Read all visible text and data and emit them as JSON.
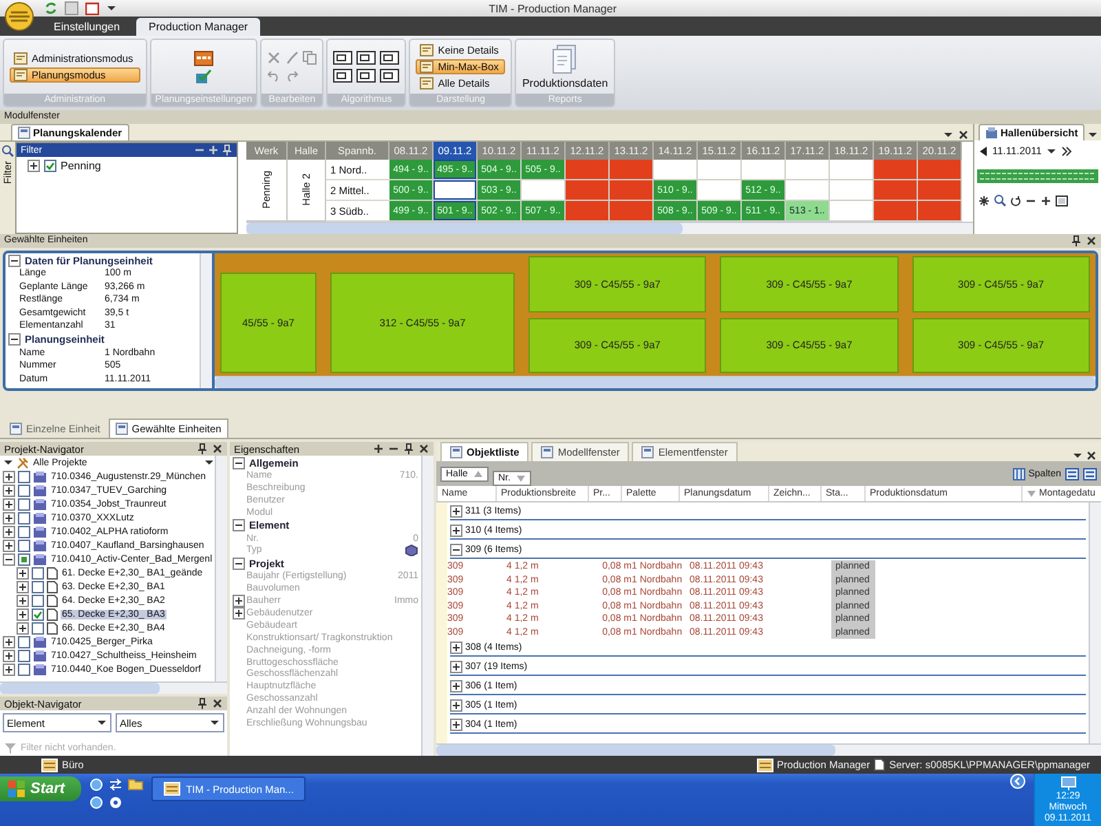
{
  "title_bar": {
    "title": "TIM - Production Manager"
  },
  "ribbon": {
    "tabs": [
      {
        "label": "Einstellungen",
        "selected": false
      },
      {
        "label": "Production Manager",
        "selected": true
      }
    ],
    "groups": [
      {
        "title": "Administration",
        "kind": "modes",
        "items": [
          {
            "label": "Administrationsmodus",
            "selected": false
          },
          {
            "label": "Planungsmodus",
            "selected": true
          }
        ]
      },
      {
        "title": "Planungseinstellungen",
        "kind": "settings"
      },
      {
        "title": "Bearbeiten",
        "kind": "edit"
      },
      {
        "title": "Algorithmus",
        "kind": "layout"
      },
      {
        "title": "Darstellung",
        "kind": "modes",
        "items": [
          {
            "label": "Keine Details",
            "selected": false
          },
          {
            "label": "Min-Max-Box",
            "selected": true
          },
          {
            "label": "Alle Details",
            "selected": false
          }
        ]
      },
      {
        "title": "Reports",
        "kind": "report",
        "button": "Produktionsdaten"
      }
    ]
  },
  "module_window": {
    "title": "Modulfenster",
    "tab": "Planungskalender",
    "filter": {
      "side_label": "Filter",
      "title": "Filter",
      "items": [
        {
          "label": "Penning",
          "checked": true
        }
      ]
    },
    "calendar": {
      "headers": [
        "Werk",
        "Halle",
        "Spannb."
      ],
      "werk": "Penning",
      "halle": "Halle 2",
      "dates": [
        {
          "label": "08.11.2",
          "selected": false
        },
        {
          "label": "09.11.2",
          "selected": true
        },
        {
          "label": "10.11.2",
          "selected": false
        },
        {
          "label": "11.11.2",
          "selected": false
        },
        {
          "label": "12.11.2",
          "selected": false
        },
        {
          "label": "13.11.2",
          "selected": false
        },
        {
          "label": "14.11.2",
          "selected": false
        },
        {
          "label": "15.11.2",
          "selected": false
        },
        {
          "label": "16.11.2",
          "selected": false
        },
        {
          "label": "17.11.2",
          "selected": false
        },
        {
          "label": "18.11.2",
          "selected": false
        },
        {
          "label": "19.11.2",
          "selected": false
        },
        {
          "label": "20.11.2",
          "selected": false
        }
      ],
      "rows": [
        {
          "label": "1 Nord..",
          "cells": [
            {
              "kind": "planned",
              "text": "494 - 9.."
            },
            {
              "kind": "planned",
              "text": "495 - 9.."
            },
            {
              "kind": "planned",
              "text": "504 - 9.."
            },
            {
              "kind": "planned",
              "text": "505 - 9.."
            },
            {
              "kind": "blocked"
            },
            {
              "kind": "blocked"
            },
            {
              "kind": "free"
            },
            {
              "kind": "free"
            },
            {
              "kind": "free"
            },
            {
              "kind": "free"
            },
            {
              "kind": "free"
            },
            {
              "kind": "blocked"
            },
            {
              "kind": "blocked"
            }
          ]
        },
        {
          "label": "2 Mittel..",
          "cells": [
            {
              "kind": "planned",
              "text": "500 - 9.."
            },
            {
              "kind": "free"
            },
            {
              "kind": "planned",
              "text": "503 - 9.."
            },
            {
              "kind": "free"
            },
            {
              "kind": "blocked"
            },
            {
              "kind": "blocked"
            },
            {
              "kind": "planned",
              "text": "510 - 9.."
            },
            {
              "kind": "free"
            },
            {
              "kind": "planned",
              "text": "512 - 9.."
            },
            {
              "kind": "free"
            },
            {
              "kind": "free"
            },
            {
              "kind": "blocked"
            },
            {
              "kind": "blocked"
            }
          ]
        },
        {
          "label": "3 Südb..",
          "cells": [
            {
              "kind": "planned",
              "text": "499 - 9.."
            },
            {
              "kind": "planned",
              "text": "501 - 9.."
            },
            {
              "kind": "planned",
              "text": "502 - 9.."
            },
            {
              "kind": "planned",
              "text": "507 - 9.."
            },
            {
              "kind": "blocked"
            },
            {
              "kind": "blocked"
            },
            {
              "kind": "planned",
              "text": "508 - 9.."
            },
            {
              "kind": "planned",
              "text": "509 - 9.."
            },
            {
              "kind": "planned",
              "text": "511 - 9.."
            },
            {
              "kind": "partial",
              "text": "513 - 1.."
            },
            {
              "kind": "free"
            },
            {
              "kind": "blocked"
            },
            {
              "kind": "blocked"
            }
          ]
        }
      ]
    },
    "hall_overview": {
      "tab": "Hallenübersicht",
      "date": "11.11.2011"
    }
  },
  "selected_units": {
    "title": "Gewählte Einheiten",
    "groups": [
      {
        "title": "Daten für Planungseinheit",
        "rows": [
          {
            "label": "Länge",
            "value": "100 m"
          },
          {
            "label": "Geplante Länge",
            "value": "93,266 m"
          },
          {
            "label": "Restlänge",
            "value": "6,734 m"
          },
          {
            "label": "Gesamtgewicht",
            "value": "39,5 t"
          },
          {
            "label": "Elementanzahl",
            "value": "31"
          }
        ]
      },
      {
        "title": "Planungseinheit",
        "rows": [
          {
            "label": "Name",
            "value": "1 Nordbahn"
          },
          {
            "label": "Nummer",
            "value": "505"
          },
          {
            "label": "Datum",
            "value": "11.11.2011"
          }
        ]
      }
    ],
    "units": [
      {
        "label": "45/55 -  9a7",
        "kind": "full"
      },
      {
        "label": "312 - C45/55 -  9a7",
        "kind": "full"
      },
      {
        "label": "309 - C45/55 -  9a7",
        "kind": "half"
      },
      {
        "label": "309 - C45/55 -  9a7",
        "kind": "half"
      },
      {
        "label": "309 - C45/55 -  9a7",
        "kind": "half"
      },
      {
        "label": "309 - C45/55 -  9a7",
        "kind": "half"
      },
      {
        "label": "309 - C45/55 -  9a7",
        "kind": "half"
      },
      {
        "label": "309 - C45/55 -  9a7",
        "kind": "half"
      }
    ]
  },
  "view_tabs": [
    {
      "label": "Einzelne Einheit",
      "selected": false
    },
    {
      "label": "Gewählte Einheiten",
      "selected": true
    }
  ],
  "project_navigator": {
    "title": "Projekt-Navigator",
    "root": "Alle Projekte",
    "items": [
      {
        "label": "710.0346_Augustenstr.29_München",
        "kind": "project",
        "checked": false,
        "indeterminate": false,
        "selected": false,
        "expanded": false
      },
      {
        "label": "710.0347_TUEV_Garching",
        "kind": "project",
        "checked": false,
        "indeterminate": false,
        "selected": false,
        "expanded": false
      },
      {
        "label": "710.0354_Jobst_Traunreut",
        "kind": "project",
        "checked": false,
        "indeterminate": false,
        "selected": false,
        "expanded": false
      },
      {
        "label": "710.0370_XXXLutz",
        "kind": "project",
        "checked": false,
        "indeterminate": false,
        "selected": false,
        "expanded": false
      },
      {
        "label": "710.0402_ALPHA ratioform",
        "kind": "project",
        "checked": false,
        "indeterminate": false,
        "selected": false,
        "expanded": false
      },
      {
        "label": "710.0407_Kaufland_Barsinghausen",
        "kind": "project",
        "checked": false,
        "indeterminate": false,
        "selected": false,
        "expanded": false
      },
      {
        "label": "710.0410_Activ-Center_Bad_Mergenl",
        "kind": "project",
        "checked": false,
        "indeterminate": true,
        "selected": false,
        "expanded": true,
        "children": [
          {
            "label": "61. Decke E+2,30_ BA1_geände",
            "kind": "document",
            "checked": false,
            "indeterminate": false,
            "selected": false,
            "expanded": false
          },
          {
            "label": "63. Decke E+2,30_ BA1",
            "kind": "document",
            "checked": false,
            "indeterminate": false,
            "selected": false,
            "expanded": false
          },
          {
            "label": "64. Decke E+2,30_ BA2",
            "kind": "document",
            "checked": false,
            "indeterminate": false,
            "selected": false,
            "expanded": false
          },
          {
            "label": "65. Decke E+2,30_ BA3",
            "kind": "document",
            "checked": true,
            "indeterminate": false,
            "selected": true,
            "expanded": false
          },
          {
            "label": "66. Decke E+2,30_ BA4",
            "kind": "document",
            "checked": false,
            "indeterminate": false,
            "selected": false,
            "expanded": false
          }
        ]
      },
      {
        "label": "710.0425_Berger_Pirka",
        "kind": "project",
        "checked": false,
        "indeterminate": false,
        "selected": false,
        "expanded": false
      },
      {
        "label": "710.0427_Schultheiss_Heinsheim",
        "kind": "project",
        "checked": false,
        "indeterminate": false,
        "selected": false,
        "expanded": false
      },
      {
        "label": "710.0440_Koe Bogen_Duesseldorf",
        "kind": "project",
        "checked": false,
        "indeterminate": false,
        "selected": false,
        "expanded": false
      }
    ]
  },
  "object_navigator": {
    "title": "Objekt-Navigator",
    "type": "Element",
    "filter": "Alles",
    "footer": "Filter nicht vorhanden."
  },
  "properties": {
    "title": "Eigenschaften",
    "groups": [
      {
        "title": "Allgemein",
        "rows": [
          {
            "label": "Name",
            "kind": "text",
            "value": "710."
          },
          {
            "label": "Beschreibung",
            "kind": "text"
          },
          {
            "label": "Benutzer",
            "kind": "text"
          },
          {
            "label": "Modul",
            "kind": "text"
          }
        ]
      },
      {
        "title": "Element",
        "rows": [
          {
            "label": "Nr.",
            "kind": "text",
            "value": "0"
          },
          {
            "label": "Typ",
            "kind": "icon"
          }
        ]
      },
      {
        "title": "Projekt",
        "rows": [
          {
            "label": "Baujahr (Fertigstellung)",
            "kind": "text",
            "value": "2011"
          },
          {
            "label": "Bauvolumen",
            "kind": "text"
          },
          {
            "label": "Bauherr",
            "kind": "group",
            "value": "Immo"
          },
          {
            "label": "Gebäudenutzer",
            "kind": "group"
          },
          {
            "label": "Gebäudeart",
            "kind": "text"
          },
          {
            "label": "Konstruktionsart/ Tragkonstruktion",
            "kind": "text"
          },
          {
            "label": "Dachneigung, -form",
            "kind": "text"
          },
          {
            "label": "Bruttogeschossfläche",
            "kind": "text"
          },
          {
            "label": "Geschossflächenzahl",
            "kind": "text"
          },
          {
            "label": "Hauptnutzfläche",
            "kind": "text"
          },
          {
            "label": "Geschossanzahl",
            "kind": "text"
          },
          {
            "label": "Anzahl der Wohnungen",
            "kind": "text"
          },
          {
            "label": "Erschließung Wohnungsbau",
            "kind": "text"
          }
        ]
      }
    ]
  },
  "object_list": {
    "tabs": [
      {
        "label": "Objektliste",
        "selected": true
      },
      {
        "label": "Modellfenster",
        "selected": false
      },
      {
        "label": "Elementfenster",
        "selected": false
      }
    ],
    "group_by": [
      "Halle",
      "Nr."
    ],
    "columns_button": "Spalten",
    "columns": [
      "Name",
      "Produktionsbreite",
      "Pr...",
      "Palette",
      "Planungsdatum",
      "Zeichn...",
      "Sta...",
      "Produktionsdatum",
      "Montagedatu"
    ],
    "groups": [
      {
        "label": "311 (3 Items)",
        "expanded": false
      },
      {
        "label": "310 (4 Items)",
        "expanded": false
      },
      {
        "label": "309 (6 Items)",
        "expanded": true,
        "rows": [
          {
            "name": "309",
            "breite": "4 1,2 m",
            "pr": "0,08 m",
            "palette": "1 Nordbahn",
            "planungsdatum": "08.11.2011 09:43",
            "status": "planned"
          },
          {
            "name": "309",
            "breite": "4 1,2 m",
            "pr": "0,08 m",
            "palette": "1 Nordbahn",
            "planungsdatum": "08.11.2011 09:43",
            "status": "planned"
          },
          {
            "name": "309",
            "breite": "4 1,2 m",
            "pr": "0,08 m",
            "palette": "1 Nordbahn",
            "planungsdatum": "08.11.2011 09:43",
            "status": "planned"
          },
          {
            "name": "309",
            "breite": "4 1,2 m",
            "pr": "0,08 m",
            "palette": "1 Nordbahn",
            "planungsdatum": "08.11.2011 09:43",
            "status": "planned"
          },
          {
            "name": "309",
            "breite": "4 1,2 m",
            "pr": "0,08 m",
            "palette": "1 Nordbahn",
            "planungsdatum": "08.11.2011 09:43",
            "status": "planned"
          },
          {
            "name": "309",
            "breite": "4 1,2 m",
            "pr": "0,08 m",
            "palette": "1 Nordbahn",
            "planungsdatum": "08.11.2011 09:43",
            "status": "planned"
          }
        ]
      },
      {
        "label": "308 (4 Items)",
        "expanded": false
      },
      {
        "label": "307 (19 Items)",
        "expanded": false
      },
      {
        "label": "306 (1 Item)",
        "expanded": false
      },
      {
        "label": "305 (1 Item)",
        "expanded": false
      },
      {
        "label": "304 (1 Item)",
        "expanded": false
      }
    ]
  },
  "status_bar": {
    "workspace": "Büro",
    "app": "Production Manager",
    "server": "Server: s0085KL\\PPMANAGER\\ppmanager"
  },
  "taskbar": {
    "start": "Start",
    "task": "TIM - Production Man...",
    "time": "12:29",
    "day": "Mittwoch",
    "date": "09.11.2011"
  }
}
